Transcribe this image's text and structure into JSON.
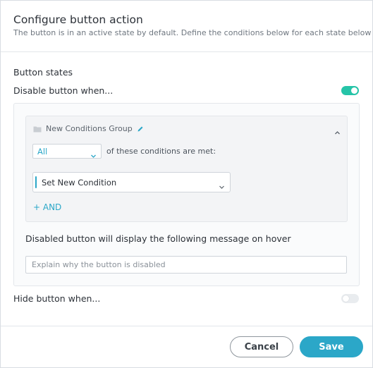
{
  "dialog": {
    "title": "Configure button action",
    "subtitle": "The button is in an active state by default. Define the conditions below for each state below"
  },
  "states": {
    "heading": "Button states",
    "disable": {
      "label": "Disable button when...",
      "enabled": true
    },
    "hide": {
      "label": "Hide button when...",
      "enabled": false
    }
  },
  "conditions_group": {
    "name": "New Conditions Group",
    "match_select": {
      "value": "All"
    },
    "match_text": "of these conditions are met:",
    "condition": {
      "value": "Set New Condition"
    },
    "add_and_label": "+ AND"
  },
  "hover_message": {
    "label": "Disabled button will display the following message on hover",
    "placeholder": "Explain why the button is disabled",
    "value": ""
  },
  "footer": {
    "cancel_label": "Cancel",
    "save_label": "Save"
  },
  "colors": {
    "accent": "#2ba7c8",
    "toggle_on": "#26c4a8",
    "toggle_off": "#e9ecef"
  },
  "icons": {
    "folder": "folder-icon",
    "pencil": "pencil-icon",
    "collapse": "chevron-up-icon",
    "dropdown": "chevron-down-icon"
  }
}
